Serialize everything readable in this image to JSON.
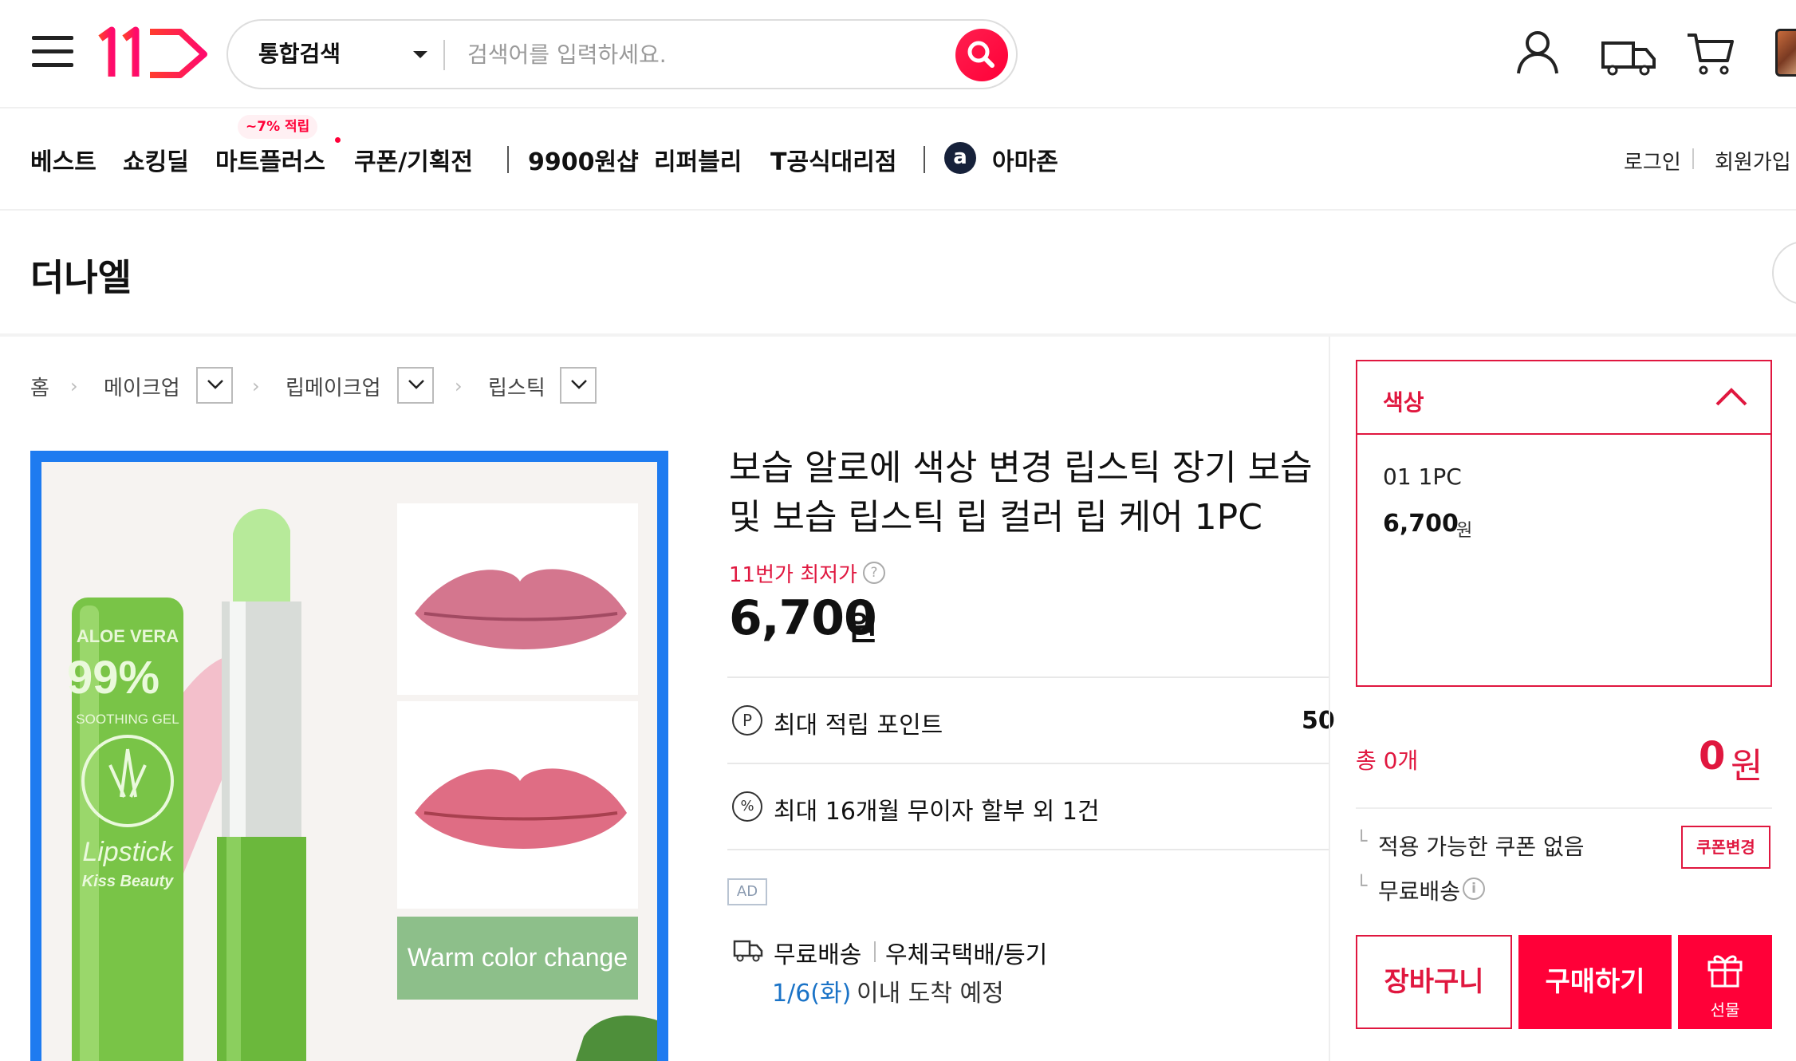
{
  "header": {
    "logo_text": "11번가",
    "search": {
      "category": "통합검색",
      "placeholder": "검색어를 입력하세요."
    }
  },
  "nav": {
    "items": [
      "베스트",
      "쇼킹딜",
      "마트플러스",
      "쿠폰/기획전",
      "9900원샵",
      "리퍼블리",
      "T공식대리점",
      "아마존"
    ],
    "mart_badge": "~7% 적립",
    "amazon_icon_letter": "a",
    "login": "로그인",
    "signup": "회원가입"
  },
  "store": {
    "name": "더나엘"
  },
  "breadcrumb": [
    "홈",
    "메이크업",
    "립메이크업",
    "립스틱"
  ],
  "product": {
    "image_texts": {
      "aloe": "ALOE VERA",
      "percent": "99%",
      "soothing": "SOOTHING GEL",
      "lipstick": "Lipstick",
      "brand": "Kiss Beauty",
      "caption": "Warm color change"
    },
    "title": "보습 알로에 색상 변경 립스틱 장기 보습 및 보습 립스틱 립 컬러 립 케어 1PC",
    "lowest_label": "11번가 최저가",
    "help_mark": "?",
    "price": "6,700",
    "price_unit": "원",
    "point_icon": "P",
    "point_label": "최대 적립 포인트",
    "point_value": "50",
    "installment_icon": "%",
    "installment_text": "최대 16개월 무이자 할부 외 1건",
    "ad_label": "AD",
    "shipping_fee": "무료배송",
    "shipping_method": "우체국택배/등기",
    "arrival_date": "1/6(화)",
    "arrival_text": "이내 도착 예정"
  },
  "panel": {
    "option_label": "색상",
    "option_item": {
      "name": "01 1PC",
      "price": "6,700",
      "unit": "원"
    },
    "total_count": "총 0개",
    "total_price": "0",
    "total_unit": "원",
    "sub_mark": "└",
    "coupon_text": "적용 가능한 쿠폰 없음",
    "coupon_button": "쿠폰변경",
    "shipping_text": "무료배송",
    "info_mark": "i",
    "cart_button": "장바구니",
    "buy_button": "구매하기",
    "gift_button": "선물"
  },
  "colors": {
    "accent": "#ff0038",
    "accent_text": "#e0173f",
    "image_border": "#1e7bf0",
    "link_blue": "#1a73c7"
  }
}
